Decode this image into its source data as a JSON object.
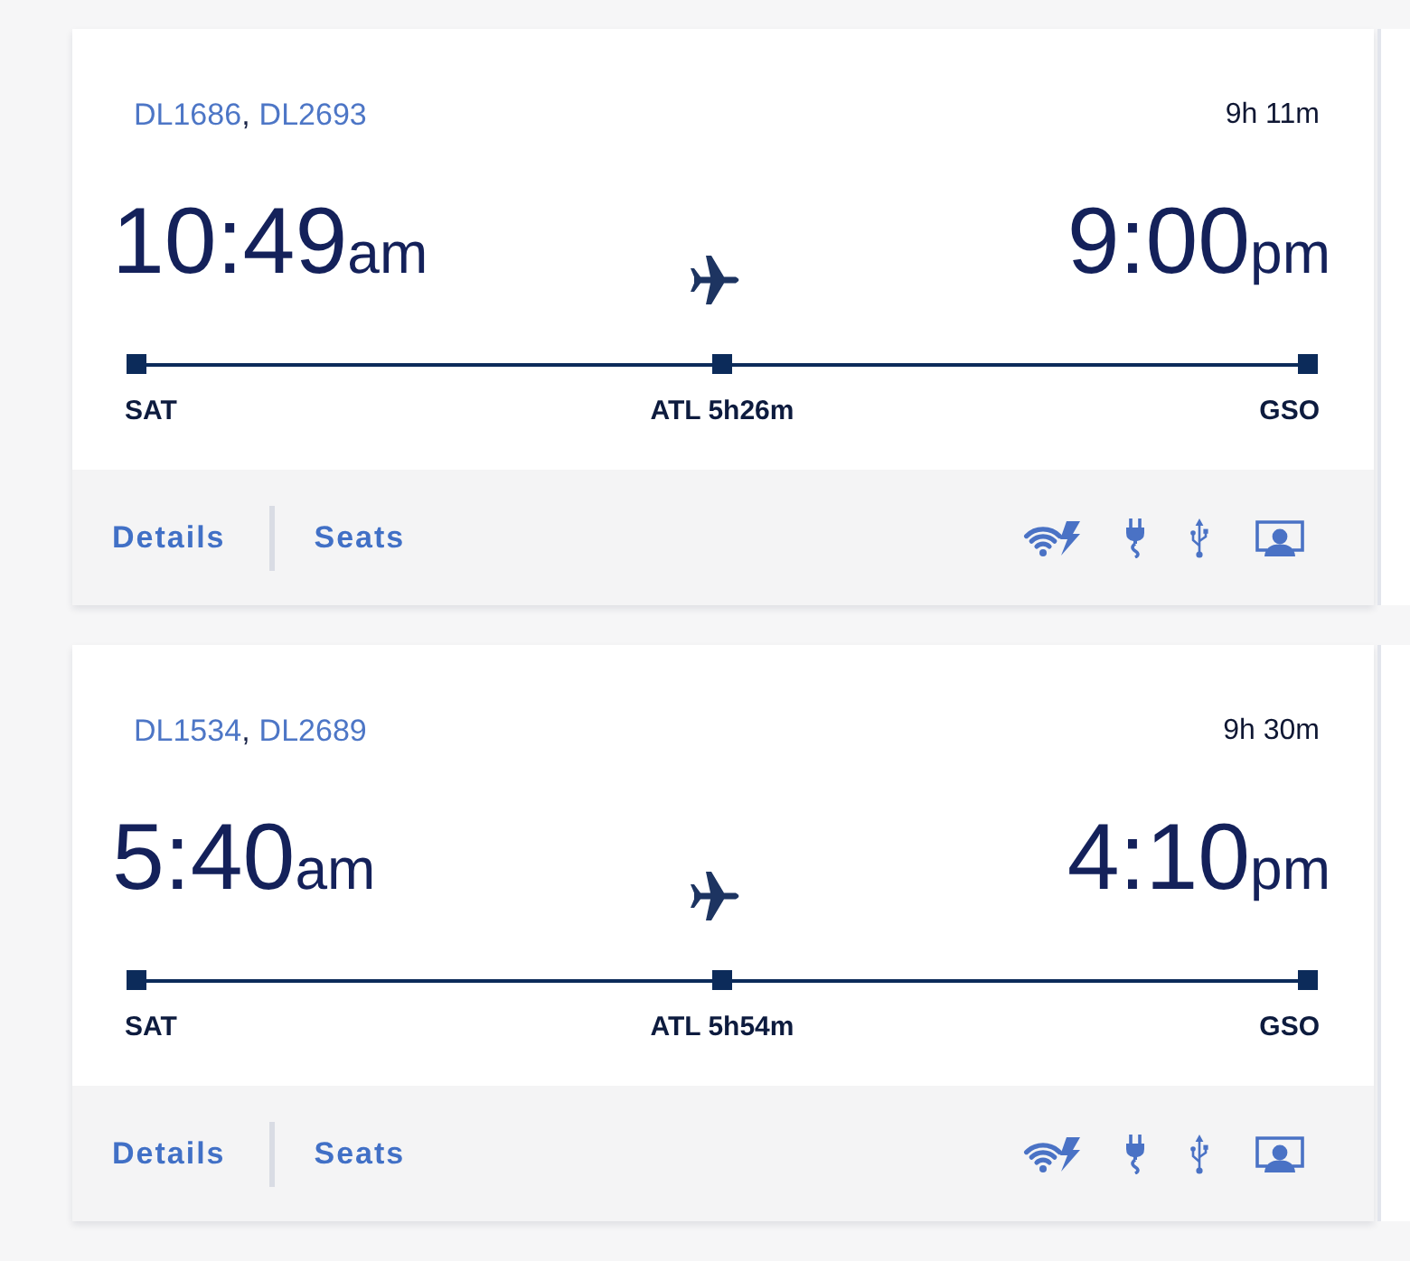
{
  "flights": [
    {
      "flight_numbers": [
        "DL1686",
        "DL2693"
      ],
      "separator": ",",
      "duration": "9h 11m",
      "departure": {
        "time": "10:49",
        "period": "am"
      },
      "arrival": {
        "time": "9:00",
        "period": "pm"
      },
      "stops": [
        "SAT",
        "ATL 5h26m",
        "GSO"
      ],
      "actions": [
        "Details",
        "Seats"
      ],
      "amenities": [
        {
          "kind": "wifi"
        },
        {
          "kind": "power"
        },
        {
          "kind": "usb"
        },
        {
          "kind": "screen"
        }
      ]
    },
    {
      "flight_numbers": [
        "DL1534",
        "DL2689"
      ],
      "separator": ",",
      "duration": "9h 30m",
      "departure": {
        "time": "5:40",
        "period": "am"
      },
      "arrival": {
        "time": "4:10",
        "period": "pm"
      },
      "stops": [
        "SAT",
        "ATL 5h54m",
        "GSO"
      ],
      "actions": [
        "Details",
        "Seats"
      ],
      "amenities": [
        {
          "kind": "wifi"
        },
        {
          "kind": "power"
        },
        {
          "kind": "usb"
        },
        {
          "kind": "screen"
        }
      ]
    }
  ]
}
